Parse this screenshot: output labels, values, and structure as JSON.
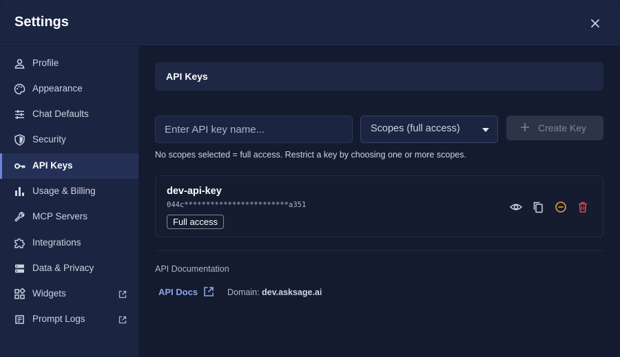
{
  "header": {
    "title": "Settings"
  },
  "sidebar": {
    "items": [
      {
        "label": "Profile",
        "icon": "user-icon"
      },
      {
        "label": "Appearance",
        "icon": "palette-icon"
      },
      {
        "label": "Chat Defaults",
        "icon": "sliders-icon"
      },
      {
        "label": "Security",
        "icon": "shield-icon"
      },
      {
        "label": "API Keys",
        "icon": "key-icon",
        "active": true
      },
      {
        "label": "Usage & Billing",
        "icon": "bar-chart-icon"
      },
      {
        "label": "MCP Servers",
        "icon": "wrench-icon"
      },
      {
        "label": "Integrations",
        "icon": "puzzle-icon"
      },
      {
        "label": "Data & Privacy",
        "icon": "database-icon"
      },
      {
        "label": "Widgets",
        "icon": "widgets-icon",
        "external": true
      },
      {
        "label": "Prompt Logs",
        "icon": "logs-icon",
        "external": true
      }
    ]
  },
  "main": {
    "section_title": "API Keys",
    "key_input_placeholder": "Enter API key name...",
    "scopes_selected": "Scopes (full access)",
    "create_label": "Create Key",
    "hint": "No scopes selected = full access. Restrict a key by choosing one or more scopes.",
    "keys": [
      {
        "name": "dev-api-key",
        "masked": "044c************************a351",
        "access": "Full access"
      }
    ],
    "docs": {
      "label": "API Documentation",
      "link": "API Docs",
      "domain_label": "Domain:",
      "domain": "dev.asksage.ai"
    }
  },
  "colors": {
    "accent": "#6f86d6",
    "link": "#8aa6e8",
    "warning": "#f0a030",
    "danger": "#e5484d"
  }
}
